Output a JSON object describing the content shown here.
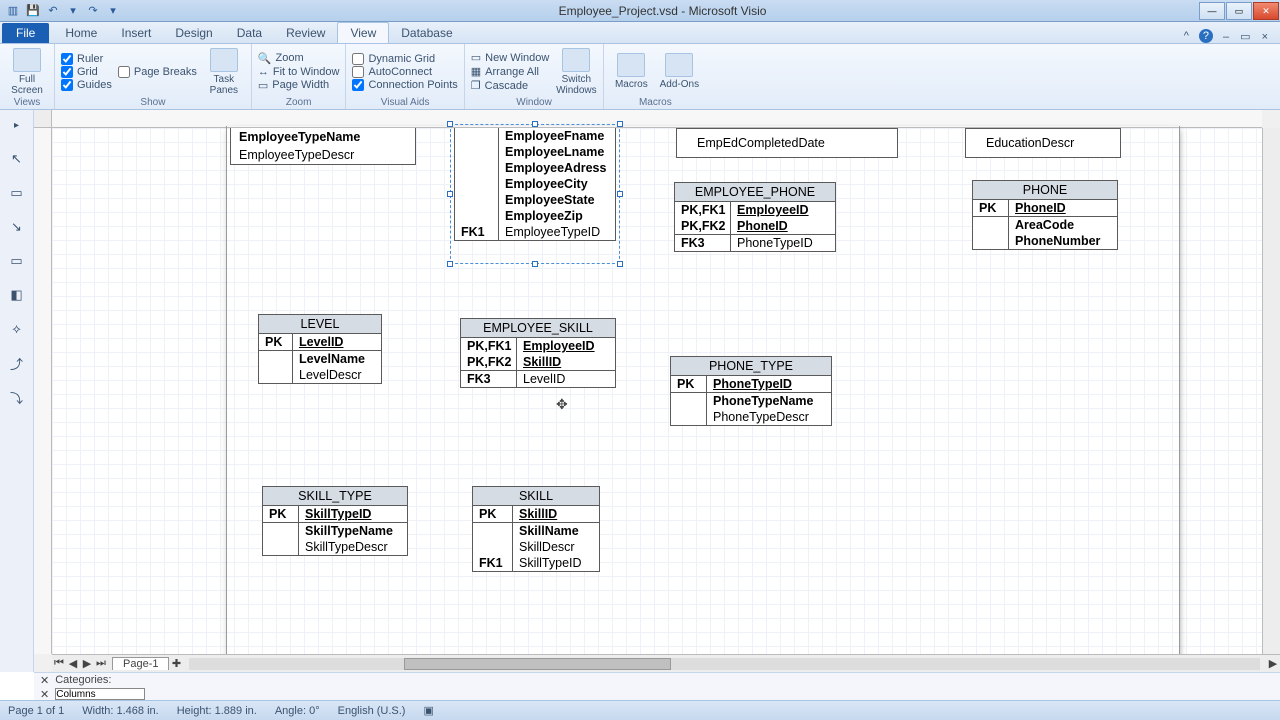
{
  "titlebar": {
    "document_title": "Employee_Project.vsd - Microsoft Visio"
  },
  "qat": {
    "save_tip": "💾",
    "undo_tip": "↶",
    "redo_tip": "↷",
    "dd": "▾"
  },
  "tabs": {
    "file": "File",
    "items": [
      "Home",
      "Insert",
      "Design",
      "Data",
      "Review",
      "View",
      "Database"
    ],
    "active_index": 5,
    "help_tip": "?"
  },
  "ribbon": {
    "groups": {
      "views": {
        "label": "Views",
        "full_screen": "Full\nScreen"
      },
      "show": {
        "label": "Show",
        "ruler": "Ruler",
        "grid": "Grid",
        "guides": "Guides",
        "page_breaks": "Page Breaks",
        "task_panes": "Task\nPanes"
      },
      "zoom": {
        "label": "Zoom",
        "zoom": "Zoom",
        "fit": "Fit to Window",
        "width": "Page Width"
      },
      "visual_aids": {
        "label": "Visual Aids",
        "dyn": "Dynamic Grid",
        "auto": "AutoConnect",
        "cp": "Connection Points"
      },
      "window": {
        "label": "Window",
        "new": "New Window",
        "arrange": "Arrange All",
        "cascade": "Cascade",
        "switch": "Switch\nWindows"
      },
      "macros": {
        "label": "Macros",
        "macros": "Macros",
        "addons": "Add-Ons"
      }
    }
  },
  "entities": {
    "employee_top": {
      "attrs": [
        "EmployeeTypeName",
        "EmployeeTypeDescr"
      ]
    },
    "employee_center": {
      "attrs": [
        "EmployeeFname",
        "EmployeeLname",
        "EmployeeAdress",
        "EmployeeCity",
        "EmployeeState",
        "EmployeeZip",
        "EmployeeTypeID"
      ],
      "fk1": "FK1"
    },
    "emped": {
      "label": "EmpEdCompletedDate"
    },
    "edu": {
      "label": "EducationDescr"
    },
    "level": {
      "title": "LEVEL",
      "pk": "PK",
      "pk_attr": "LevelID",
      "attrs": [
        "LevelName",
        "LevelDescr"
      ]
    },
    "employee_skill": {
      "title": "EMPLOYEE_SKILL",
      "k1": "PK,FK1",
      "a1": "EmployeeID",
      "k2": "PK,FK2",
      "a2": "SkillID",
      "k3": "FK3",
      "a3": "LevelID"
    },
    "employee_phone": {
      "title": "EMPLOYEE_PHONE",
      "k1": "PK,FK1",
      "a1": "EmployeeID",
      "k2": "PK,FK2",
      "a2": "PhoneID",
      "k3": "FK3",
      "a3": "PhoneTypeID"
    },
    "phone": {
      "title": "PHONE",
      "pk": "PK",
      "pk_attr": "PhoneID",
      "attrs": [
        "AreaCode",
        "PhoneNumber"
      ]
    },
    "phone_type": {
      "title": "PHONE_TYPE",
      "pk": "PK",
      "pk_attr": "PhoneTypeID",
      "attrs": [
        "PhoneTypeName",
        "PhoneTypeDescr"
      ]
    },
    "skill_type": {
      "title": "SKILL_TYPE",
      "pk": "PK",
      "pk_attr": "SkillTypeID",
      "attrs": [
        "SkillTypeName",
        "SkillTypeDescr"
      ]
    },
    "skill": {
      "title": "SKILL",
      "pk": "PK",
      "pk_attr": "SkillID",
      "attrs": [
        "SkillName",
        "SkillDescr",
        "SkillTypeID"
      ],
      "fk1": "FK1"
    }
  },
  "pagetab": {
    "name": "Page-1"
  },
  "lowerpanel": {
    "categories": "Categories:",
    "columns": "Columns"
  },
  "status": {
    "page": "Page 1 of 1",
    "width": "Width: 1.468 in.",
    "height": "Height: 1.889 in.",
    "angle": "Angle: 0°",
    "lang": "English (U.S.)"
  }
}
